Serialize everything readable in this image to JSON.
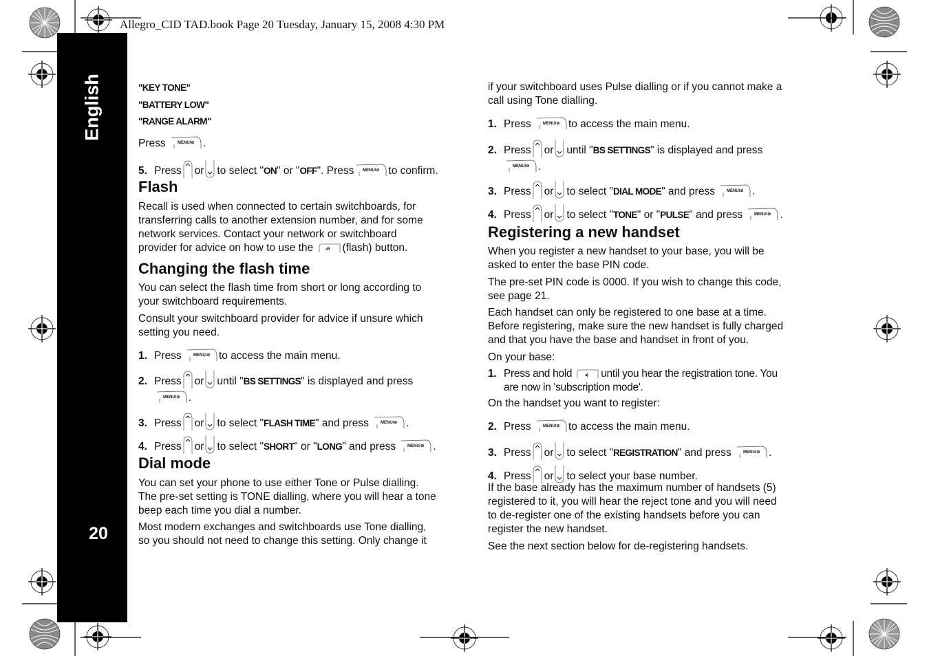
{
  "header": {
    "text": "Allegro_CID TAD.book  Page 20  Tuesday, January 15, 2008  4:30 PM"
  },
  "tab": {
    "language": "English",
    "page_number": "20"
  },
  "icons": {
    "menu_key": "MENU/Ø",
    "up_key": "up-arrow-key",
    "down_key": "down-arrow-key",
    "flash_key": "R/flash-key",
    "page_key": "paging-key"
  },
  "left": {
    "tones": [
      "\"KEY TONE\"",
      "\"BATTERY LOW\"",
      "\"RANGE ALARM\""
    ],
    "press_word": "Press",
    "step5": {
      "num": "5.",
      "t1": "Press",
      "t2": "or",
      "t3": "to select \"",
      "on": "ON",
      "t4": "\" or \"",
      "off": "OFF",
      "t5": "\". Press",
      "t6": "to confirm."
    },
    "flash": {
      "title": "Flash",
      "lines": [
        "Recall is used when connected to certain switchboards, for",
        "transferring calls to another extension number, and for some",
        "network services. Contact your network or switchboard"
      ],
      "last_pre": "provider for advice on how to use the",
      "last_post": "(flash) button."
    },
    "flash_time": {
      "title": "Changing the flash time",
      "p1": [
        "You can select the flash time from short or long according to",
        "your switchboard requirements."
      ],
      "p2": [
        "Consult your switchboard provider for advice if unsure which",
        "setting you need."
      ],
      "steps": {
        "s1": {
          "num": "1.",
          "pre": "Press",
          "post": "to access the main menu."
        },
        "s2": {
          "num": "2.",
          "pre": "Press",
          "or": "or",
          "mid": "until \"",
          "kw": "BS SETTINGS",
          "post": "\" is displayed and press"
        },
        "s3": {
          "num": "3.",
          "pre": "Press",
          "or": "or",
          "mid": "to select \"",
          "kw": "FLASH TIME",
          "post": "\" and press"
        },
        "s4": {
          "num": "4.",
          "pre": "Press",
          "or": "or",
          "mid": "to select \"",
          "kw": "SHORT",
          "mid2": "\" or \"",
          "kw2": "LONG",
          "post": "\" and press"
        }
      }
    },
    "dial_mode": {
      "title": "Dial mode",
      "p1": [
        "You can set your phone to use either Tone or Pulse dialling.",
        "The pre-set setting is TONE dialling, where you will hear a tone",
        "beep each time you dial a number."
      ],
      "p2": [
        "Most modern exchanges and switchboards use Tone dialling,",
        "so you should not need to change this setting. Only change it"
      ]
    }
  },
  "right": {
    "cont": [
      "if your switchboard uses Pulse dialling or if you cannot make a",
      "call using Tone dialling."
    ],
    "steps": {
      "s1": {
        "num": "1.",
        "pre": "Press",
        "post": "to access the main menu."
      },
      "s2": {
        "num": "2.",
        "pre": "Press",
        "or": "or",
        "mid": "until \"",
        "kw": "BS SETTINGS",
        "post": "\" is displayed and press"
      },
      "s3": {
        "num": "3.",
        "pre": "Press",
        "or": "or",
        "mid": "to select \"",
        "kw": "DIAL MODE",
        "post": "\" and press"
      },
      "s4": {
        "num": "4.",
        "pre": "Press",
        "or": "or",
        "mid": "to select \"",
        "kw": "TONE",
        "mid2": "\" or \"",
        "kw2": "PULSE",
        "post": "\" and press"
      }
    },
    "register": {
      "title": "Registering a new handset",
      "p1": [
        "When you register a new handset to your base, you will be",
        "asked to enter the base PIN code."
      ],
      "p2": [
        "The pre-set PIN code is 0000. If you wish to change this code,",
        "see page 21."
      ],
      "p3": [
        "Each handset can only be registered to one base at a time.",
        "Before registering, make sure the new handset is fully charged",
        "and that you have the base and handset in front of you."
      ],
      "on_base": "On your base:",
      "b1": {
        "num": "1.",
        "pre": "Press and hold",
        "post": "until you hear the registration tone. You",
        "line2": "are now in 'subscription mode'."
      },
      "on_handset": "On the handset you want to register:",
      "h2": {
        "num": "2.",
        "pre": "Press",
        "post": "to access the main menu."
      },
      "h3": {
        "num": "3.",
        "pre": "Press",
        "or": "or",
        "mid": "to select \"",
        "kw": "REGISTRATION",
        "post": "\" and press"
      },
      "h4": {
        "num": "4.",
        "pre": "Press",
        "or": "or",
        "post": "to select your base number."
      },
      "p4": [
        "If the base already has the maximum number of handsets (5)",
        "registered to it, you will hear the reject tone and you will need",
        "to de-register one of the existing handsets before you can",
        "register the new handset."
      ],
      "p5": "See the next section below for de-registering handsets."
    }
  }
}
